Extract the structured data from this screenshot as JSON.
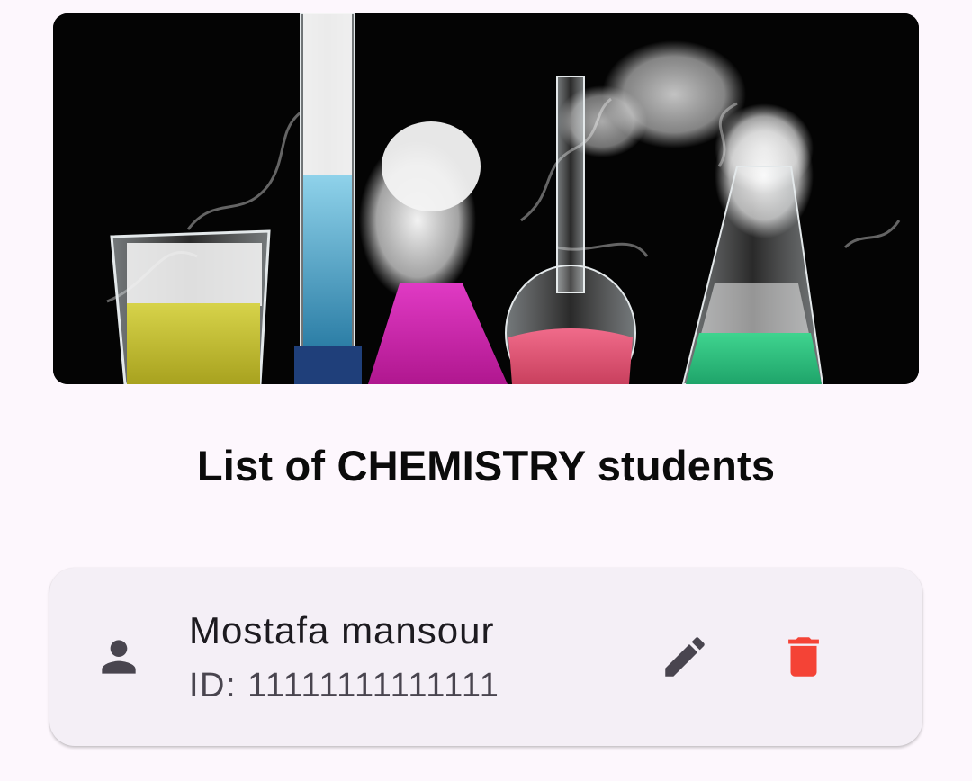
{
  "header": {
    "title": "List of CHEMISTRY students"
  },
  "students": [
    {
      "name": "Mostafa mansour",
      "id_text": "ID: 11111111111111"
    }
  ],
  "colors": {
    "background": "#fdf7fd",
    "card": "#f4eff6",
    "icon": "#49454f",
    "delete": "#f44336"
  },
  "icons": {
    "person": "person-icon",
    "edit": "pencil-icon",
    "delete": "trash-icon"
  }
}
